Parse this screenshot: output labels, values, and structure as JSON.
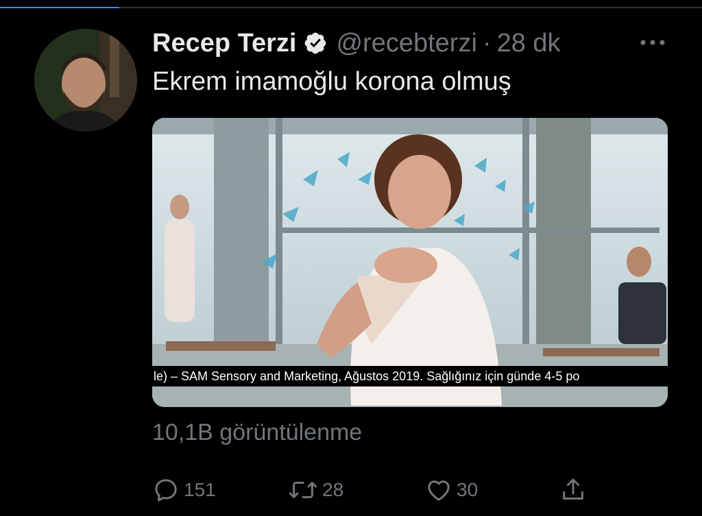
{
  "progress": {
    "fraction": 0.17,
    "color": "#1d9bf0"
  },
  "tweet": {
    "display_name": "Recep Terzi",
    "verified": true,
    "handle": "@recebterzi",
    "separator": "·",
    "time": "28 dk",
    "text": "Ekrem imamoğlu korona olmuş",
    "video_subtitle": "le) – SAM Sensory and Marketing, Ağustos 2019. Sağlığınız için günde 4-5 po",
    "views": "10,1B görüntülenme"
  },
  "actions": {
    "reply_count": "151",
    "retweet_count": "28",
    "like_count": "30"
  },
  "icons": {
    "more": "more-dots-icon",
    "verified": "verified-badge-icon",
    "reply": "reply-bubble-icon",
    "retweet": "retweet-icon",
    "like": "heart-icon",
    "share": "share-icon"
  },
  "colors": {
    "background": "#000000",
    "text": "#e7e9ea",
    "secondary": "#71767b",
    "accent": "#1d9bf0"
  }
}
